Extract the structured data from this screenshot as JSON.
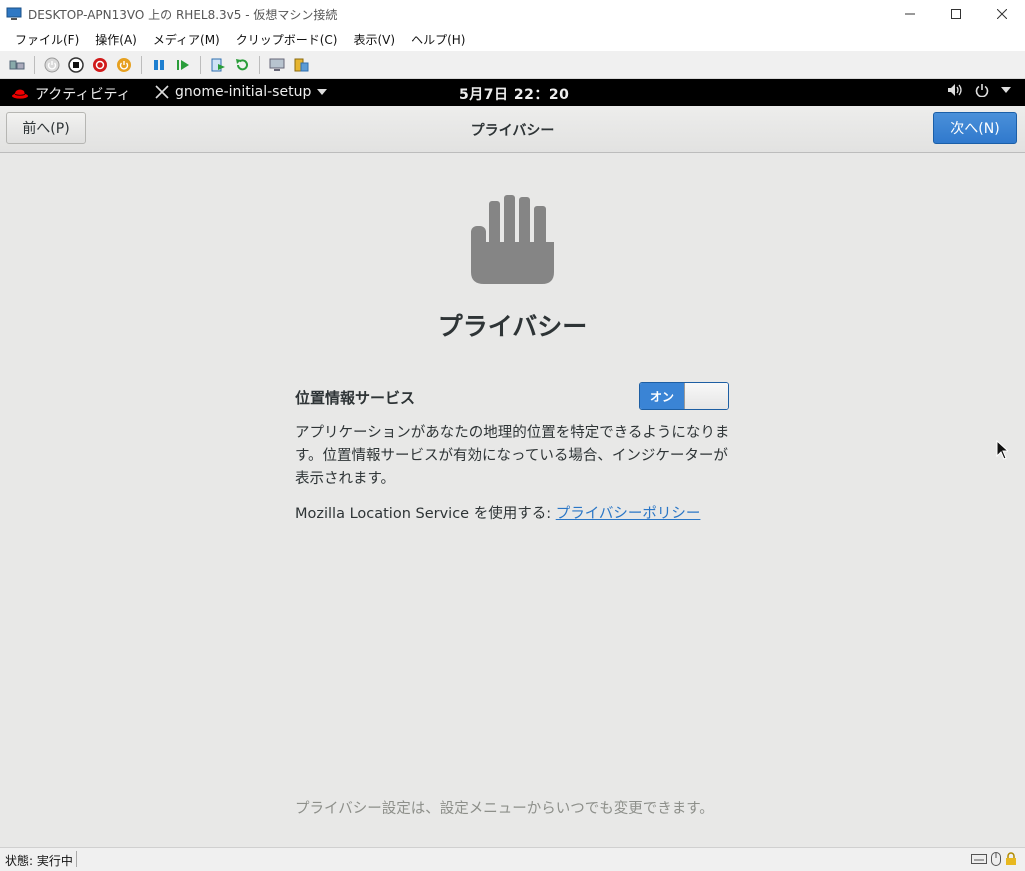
{
  "window": {
    "title": "DESKTOP-APN13VO 上の RHEL8.3v5 - 仮想マシン接続"
  },
  "menu": {
    "items": [
      "ファイル(F)",
      "操作(A)",
      "メディア(M)",
      "クリップボード(C)",
      "表示(V)",
      "ヘルプ(H)"
    ]
  },
  "gnome": {
    "activities": "アクティビティ",
    "app_menu": "gnome-initial-setup",
    "clock": "5月7日  22：20"
  },
  "header": {
    "prev_label": "前へ(P)",
    "title": "プライバシー",
    "next_label": "次へ(N)"
  },
  "main": {
    "heading": "プライバシー",
    "location_label": "位置情報サービス",
    "switch_on": "オン",
    "description": "アプリケーションがあなたの地理的位置を特定できるようになります。位置情報サービスが有効になっている場合、インジケーターが表示されます。",
    "mozilla_text": "Mozilla Location Service を使用する: ",
    "privacy_link": "プライバシーポリシー",
    "footer_note": "プライバシー設定は、設定メニューからいつでも変更できます。"
  },
  "status": {
    "text": "状態: 実行中"
  },
  "colors": {
    "accent": "#3a84d5",
    "icon_gray": "#858585"
  }
}
